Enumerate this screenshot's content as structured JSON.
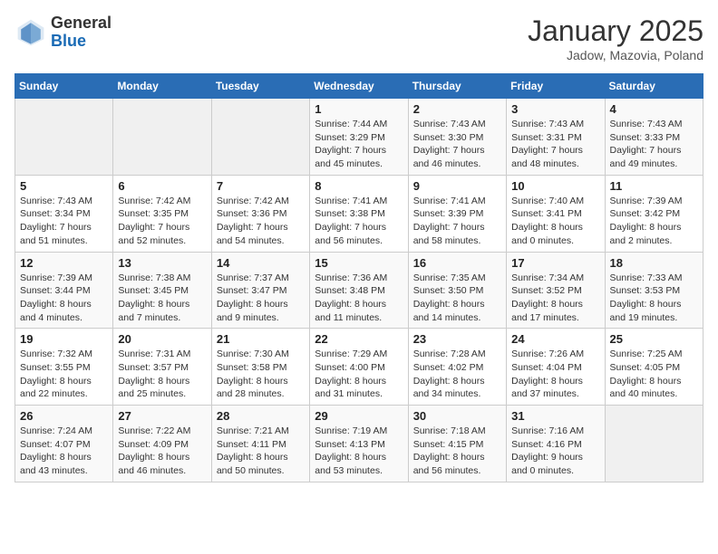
{
  "header": {
    "logo_general": "General",
    "logo_blue": "Blue",
    "title": "January 2025",
    "subtitle": "Jadow, Mazovia, Poland"
  },
  "days_of_week": [
    "Sunday",
    "Monday",
    "Tuesday",
    "Wednesday",
    "Thursday",
    "Friday",
    "Saturday"
  ],
  "weeks": [
    [
      {
        "day": "",
        "info": ""
      },
      {
        "day": "",
        "info": ""
      },
      {
        "day": "",
        "info": ""
      },
      {
        "day": "1",
        "info": "Sunrise: 7:44 AM\nSunset: 3:29 PM\nDaylight: 7 hours and 45 minutes."
      },
      {
        "day": "2",
        "info": "Sunrise: 7:43 AM\nSunset: 3:30 PM\nDaylight: 7 hours and 46 minutes."
      },
      {
        "day": "3",
        "info": "Sunrise: 7:43 AM\nSunset: 3:31 PM\nDaylight: 7 hours and 48 minutes."
      },
      {
        "day": "4",
        "info": "Sunrise: 7:43 AM\nSunset: 3:33 PM\nDaylight: 7 hours and 49 minutes."
      }
    ],
    [
      {
        "day": "5",
        "info": "Sunrise: 7:43 AM\nSunset: 3:34 PM\nDaylight: 7 hours and 51 minutes."
      },
      {
        "day": "6",
        "info": "Sunrise: 7:42 AM\nSunset: 3:35 PM\nDaylight: 7 hours and 52 minutes."
      },
      {
        "day": "7",
        "info": "Sunrise: 7:42 AM\nSunset: 3:36 PM\nDaylight: 7 hours and 54 minutes."
      },
      {
        "day": "8",
        "info": "Sunrise: 7:41 AM\nSunset: 3:38 PM\nDaylight: 7 hours and 56 minutes."
      },
      {
        "day": "9",
        "info": "Sunrise: 7:41 AM\nSunset: 3:39 PM\nDaylight: 7 hours and 58 minutes."
      },
      {
        "day": "10",
        "info": "Sunrise: 7:40 AM\nSunset: 3:41 PM\nDaylight: 8 hours and 0 minutes."
      },
      {
        "day": "11",
        "info": "Sunrise: 7:39 AM\nSunset: 3:42 PM\nDaylight: 8 hours and 2 minutes."
      }
    ],
    [
      {
        "day": "12",
        "info": "Sunrise: 7:39 AM\nSunset: 3:44 PM\nDaylight: 8 hours and 4 minutes."
      },
      {
        "day": "13",
        "info": "Sunrise: 7:38 AM\nSunset: 3:45 PM\nDaylight: 8 hours and 7 minutes."
      },
      {
        "day": "14",
        "info": "Sunrise: 7:37 AM\nSunset: 3:47 PM\nDaylight: 8 hours and 9 minutes."
      },
      {
        "day": "15",
        "info": "Sunrise: 7:36 AM\nSunset: 3:48 PM\nDaylight: 8 hours and 11 minutes."
      },
      {
        "day": "16",
        "info": "Sunrise: 7:35 AM\nSunset: 3:50 PM\nDaylight: 8 hours and 14 minutes."
      },
      {
        "day": "17",
        "info": "Sunrise: 7:34 AM\nSunset: 3:52 PM\nDaylight: 8 hours and 17 minutes."
      },
      {
        "day": "18",
        "info": "Sunrise: 7:33 AM\nSunset: 3:53 PM\nDaylight: 8 hours and 19 minutes."
      }
    ],
    [
      {
        "day": "19",
        "info": "Sunrise: 7:32 AM\nSunset: 3:55 PM\nDaylight: 8 hours and 22 minutes."
      },
      {
        "day": "20",
        "info": "Sunrise: 7:31 AM\nSunset: 3:57 PM\nDaylight: 8 hours and 25 minutes."
      },
      {
        "day": "21",
        "info": "Sunrise: 7:30 AM\nSunset: 3:58 PM\nDaylight: 8 hours and 28 minutes."
      },
      {
        "day": "22",
        "info": "Sunrise: 7:29 AM\nSunset: 4:00 PM\nDaylight: 8 hours and 31 minutes."
      },
      {
        "day": "23",
        "info": "Sunrise: 7:28 AM\nSunset: 4:02 PM\nDaylight: 8 hours and 34 minutes."
      },
      {
        "day": "24",
        "info": "Sunrise: 7:26 AM\nSunset: 4:04 PM\nDaylight: 8 hours and 37 minutes."
      },
      {
        "day": "25",
        "info": "Sunrise: 7:25 AM\nSunset: 4:05 PM\nDaylight: 8 hours and 40 minutes."
      }
    ],
    [
      {
        "day": "26",
        "info": "Sunrise: 7:24 AM\nSunset: 4:07 PM\nDaylight: 8 hours and 43 minutes."
      },
      {
        "day": "27",
        "info": "Sunrise: 7:22 AM\nSunset: 4:09 PM\nDaylight: 8 hours and 46 minutes."
      },
      {
        "day": "28",
        "info": "Sunrise: 7:21 AM\nSunset: 4:11 PM\nDaylight: 8 hours and 50 minutes."
      },
      {
        "day": "29",
        "info": "Sunrise: 7:19 AM\nSunset: 4:13 PM\nDaylight: 8 hours and 53 minutes."
      },
      {
        "day": "30",
        "info": "Sunrise: 7:18 AM\nSunset: 4:15 PM\nDaylight: 8 hours and 56 minutes."
      },
      {
        "day": "31",
        "info": "Sunrise: 7:16 AM\nSunset: 4:16 PM\nDaylight: 9 hours and 0 minutes."
      },
      {
        "day": "",
        "info": ""
      }
    ]
  ]
}
